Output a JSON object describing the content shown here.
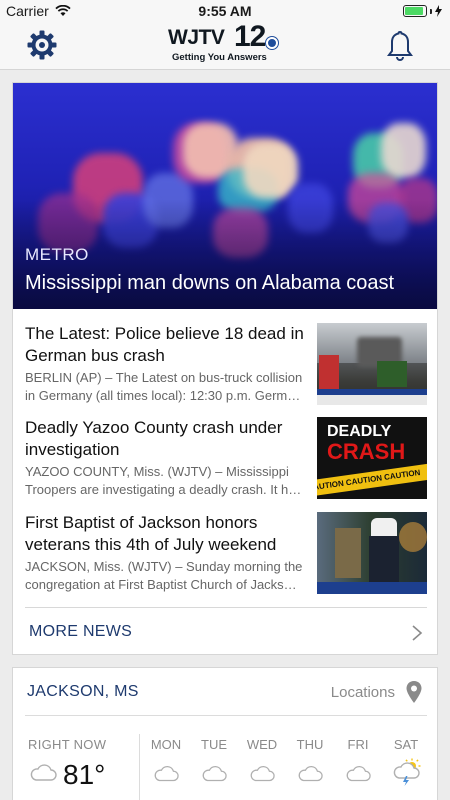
{
  "status_bar": {
    "carrier": "Carrier",
    "time": "9:55 AM",
    "battery_level": 0.9
  },
  "header": {
    "logo_main": "WJTV",
    "logo_number": "12",
    "logo_tagline": "Getting You Answers"
  },
  "hero": {
    "category": "METRO",
    "title": "Mississippi man downs on Alabama coast"
  },
  "stories": [
    {
      "title": "The Latest: Police believe 18 dead in German bus crash",
      "summary": "BERLIN (AP) – The Latest on bus-truck collision in Germany (all times local): 12:30 p.m. Germ…"
    },
    {
      "title": "Deadly Yazoo County crash under investigation",
      "summary": "YAZOO COUNTY, Miss. (WJTV) – Mississippi Troopers are investigating a deadly crash. It h…",
      "thumb_text_1": "DEADLY",
      "thumb_text_2": "CRASH",
      "thumb_tape": "CAUTION CAUTION CAUTION"
    },
    {
      "title": "First Baptist of Jackson honors veterans this 4th of July weekend",
      "summary": "JACKSON, Miss. (WJTV) – Sunday morning the congregation at First Baptist Church of Jacks…"
    }
  ],
  "more_news": {
    "label": "MORE NEWS"
  },
  "weather": {
    "city": "JACKSON, MS",
    "locations_label": "Locations",
    "right_now_label": "RIGHT NOW",
    "current_temp": "81°",
    "days": [
      {
        "label": "MON",
        "icon": "cloud-icon"
      },
      {
        "label": "TUE",
        "icon": "cloud-icon"
      },
      {
        "label": "WED",
        "icon": "cloud-icon"
      },
      {
        "label": "THU",
        "icon": "cloud-icon"
      },
      {
        "label": "FRI",
        "icon": "cloud-icon"
      },
      {
        "label": "SAT",
        "icon": "sun-storm-icon"
      }
    ]
  },
  "colors": {
    "accent": "#1e3a6e",
    "hero_blue": "#2b2fd0",
    "battery": "#4cd964"
  }
}
